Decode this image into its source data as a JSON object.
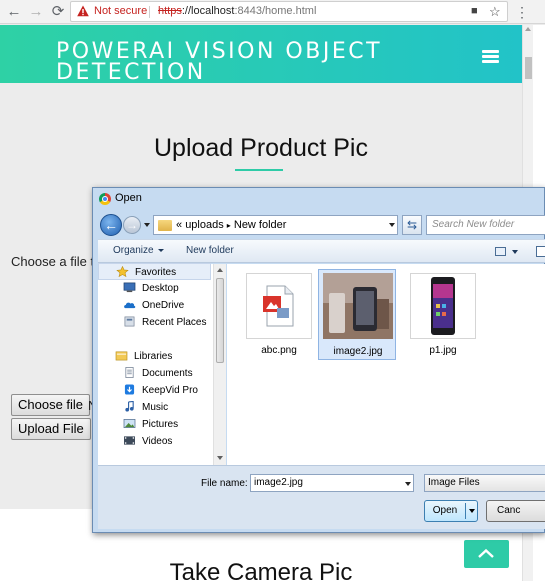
{
  "browser": {
    "not_secure": "Not secure",
    "url_scheme": "https",
    "url_host": "://localhost",
    "url_path": ":8443/home.html",
    "back_icon": "←",
    "forward_icon": "→",
    "reload_icon": "⟳",
    "menu_icon": "⋮",
    "star_icon": "☆",
    "camera_icon": "■"
  },
  "page": {
    "site_title": "POWERAI VISION OBJECT DETECTION",
    "upload_title": "Upload Product Pic",
    "choose_label": "Choose a file to",
    "choose_file_button": "Choose file",
    "no_file_text": "N",
    "upload_button": "Upload File",
    "lower_title": "Take Camera Pic",
    "accent_color": "#2ecba7"
  },
  "dialog": {
    "title": "Open",
    "path_prefix": "«",
    "path_parts": [
      "uploads",
      "New folder"
    ],
    "path_separator": "▸",
    "search_placeholder": "Search New folder",
    "organize_label": "Organize",
    "new_folder_label": "New folder",
    "nav": {
      "favorites": "Favorites",
      "desktop": "Desktop",
      "onedrive": "OneDrive",
      "recent": "Recent Places",
      "libraries": "Libraries",
      "documents": "Documents",
      "keepvid": "KeepVid Pro",
      "music": "Music",
      "pictures": "Pictures",
      "videos": "Videos"
    },
    "files": [
      {
        "name": "abc.png",
        "selected": false
      },
      {
        "name": "image2.jpg",
        "selected": true
      },
      {
        "name": "p1.jpg",
        "selected": false
      }
    ],
    "file_name_label": "File name:",
    "file_name_value": "image2.jpg",
    "file_type": "Image Files",
    "open_button": "Open",
    "cancel_button": "Canc"
  }
}
